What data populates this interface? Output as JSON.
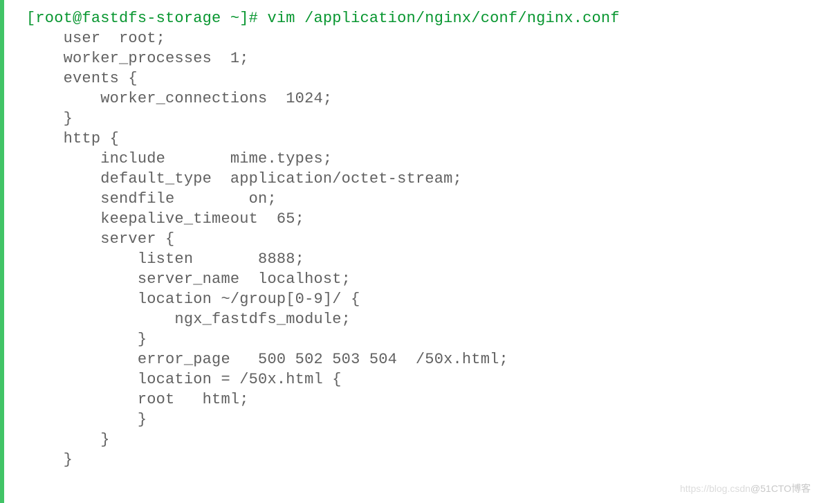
{
  "prompt": "[root@fastdfs-storage ~]# vim /application/nginx/conf/nginx.conf",
  "config": {
    "l1": "    user  root;",
    "l2": "    worker_processes  1;",
    "l3": "    events {",
    "l4": "        worker_connections  1024;",
    "l5": "    }",
    "l6": "    http {",
    "l7": "        include       mime.types;",
    "l8": "        default_type  application/octet-stream;",
    "l9": "        sendfile        on;",
    "l10": "        keepalive_timeout  65;",
    "l11": "        server {",
    "l12": "            listen       8888;",
    "l13": "            server_name  localhost;",
    "l14": "            location ~/group[0-9]/ {",
    "l15": "                ngx_fastdfs_module;",
    "l16": "            }",
    "l17": "            error_page   500 502 503 504  /50x.html;",
    "l18": "            location = /50x.html {",
    "l19": "            root   html;",
    "l20": "            }",
    "l21": "        }",
    "l22": "    }"
  },
  "watermark": {
    "left": "https://blog.csdn",
    "right": "@51CTO博客"
  }
}
